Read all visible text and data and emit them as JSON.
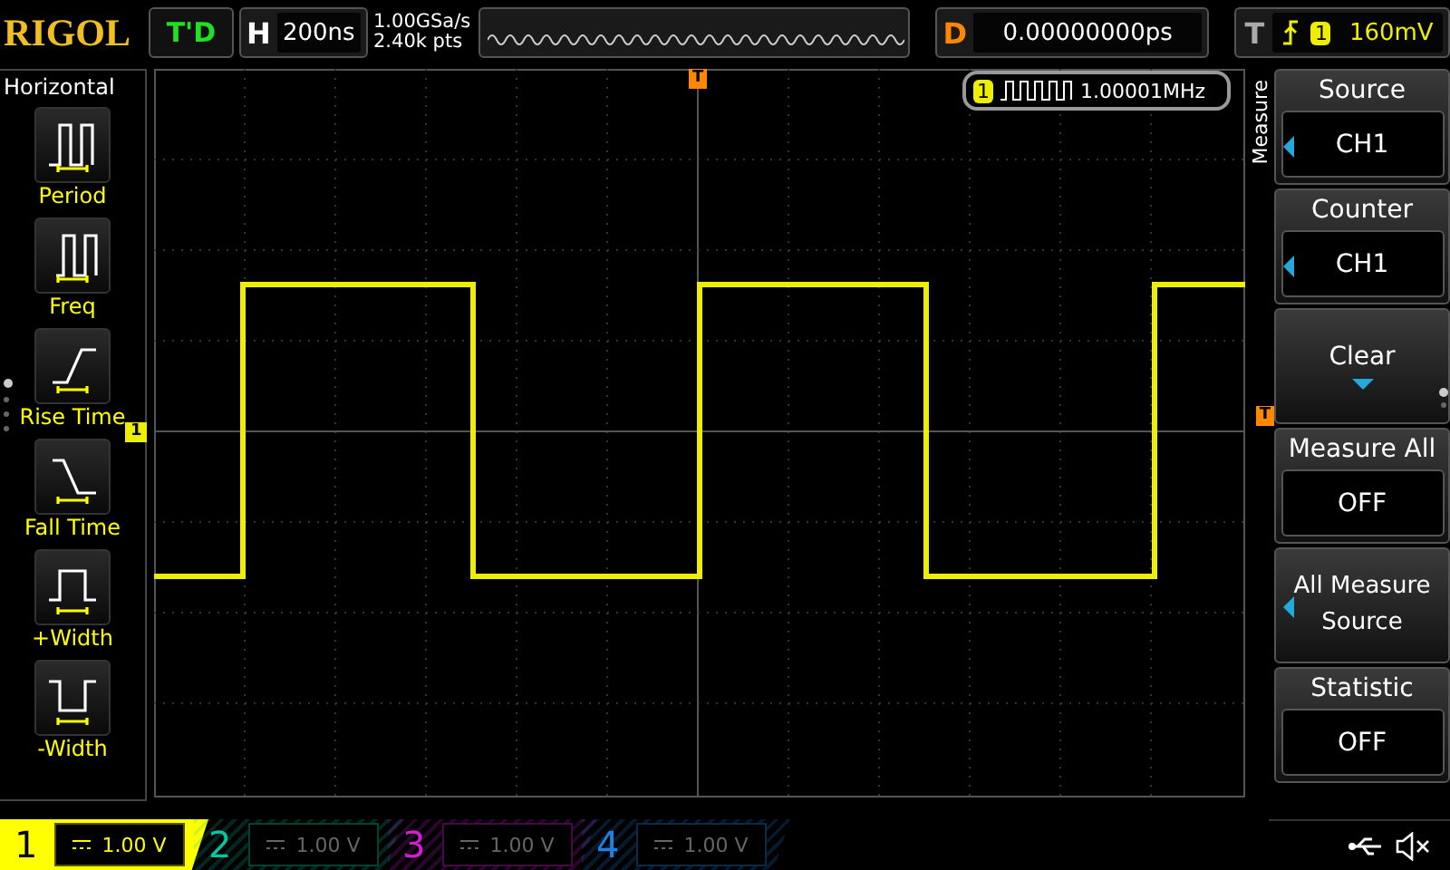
{
  "brand": "RIGOL",
  "run_status": "T'D",
  "timebase": {
    "label": "H",
    "value": "200ns"
  },
  "acquisition": {
    "rate": "1.00GSa/s",
    "depth": "2.40k pts"
  },
  "delay": {
    "label": "D",
    "value": "0.00000000ps"
  },
  "trigger": {
    "label": "T",
    "source": "1",
    "level": "160mV"
  },
  "left_panel": {
    "title": "Horizontal",
    "pages": [
      {
        "selected": true
      },
      {
        "selected": false
      },
      {
        "selected": false
      },
      {
        "selected": false
      }
    ],
    "items": [
      {
        "kind": "period",
        "label": "Period"
      },
      {
        "kind": "freq",
        "label": "Freq"
      },
      {
        "kind": "rise",
        "label": "Rise Time"
      },
      {
        "kind": "fall",
        "label": "Fall Time"
      },
      {
        "kind": "pwidth",
        "label": "+Width"
      },
      {
        "kind": "nwidth",
        "label": "-Width"
      }
    ]
  },
  "screen": {
    "trigger_position_marker": "T",
    "trigger_level_marker": "T",
    "channel_marker": "1",
    "counter": {
      "channel": "1",
      "value": "1.00001MHz"
    }
  },
  "menu": {
    "title": "Measure",
    "pages": [
      {
        "selected": true
      },
      {
        "selected": false
      }
    ],
    "items": [
      {
        "kind": "select",
        "label": "Source",
        "value": "CH1"
      },
      {
        "kind": "select",
        "label": "Counter",
        "value": "CH1"
      },
      {
        "kind": "action",
        "label": "Clear"
      },
      {
        "kind": "toggle",
        "label": "Measure All",
        "value": "OFF"
      },
      {
        "kind": "double",
        "label": "All Measure",
        "value": "Source"
      },
      {
        "kind": "toggle",
        "label": "Statistic",
        "value": "OFF"
      }
    ]
  },
  "channels": [
    {
      "number": "1",
      "scale": "1.00 V",
      "on": true,
      "color": "#ffff00"
    },
    {
      "number": "2",
      "scale": "1.00 V",
      "on": false,
      "color": "#00c8a0"
    },
    {
      "number": "3",
      "scale": "1.00 V",
      "on": false,
      "color": "#d020d0"
    },
    {
      "number": "4",
      "scale": "1.00 V",
      "on": false,
      "color": "#2080e0"
    }
  ]
}
